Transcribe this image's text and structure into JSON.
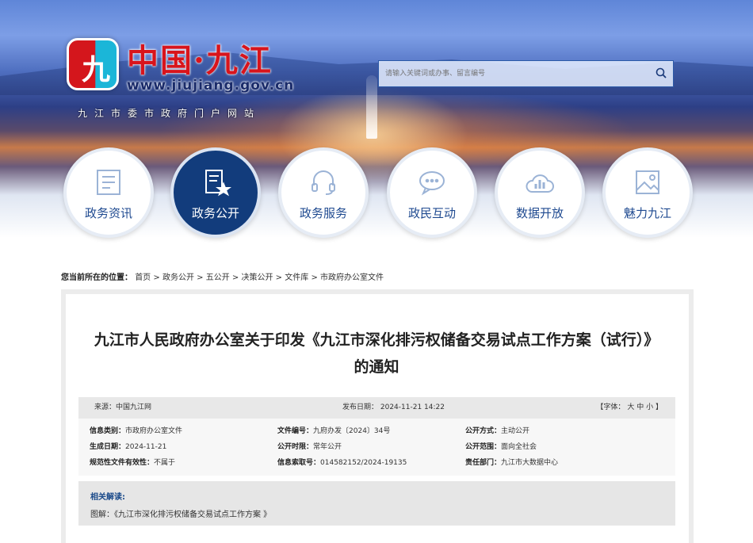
{
  "header": {
    "logo_text": "中国·九江",
    "logo_url": "www.jiujiang.gov.cn",
    "logo_sub": "九江市委市政府门户网站",
    "search_placeholder": "请输入关键词或办事、留言编号"
  },
  "nav": [
    {
      "label": "政务资讯",
      "icon": "newspaper-icon"
    },
    {
      "label": "政务公开",
      "icon": "document-star-icon",
      "active": true
    },
    {
      "label": "政务服务",
      "icon": "headset-icon"
    },
    {
      "label": "政民互动",
      "icon": "chat-icon"
    },
    {
      "label": "数据开放",
      "icon": "cloud-chart-icon"
    },
    {
      "label": "魅力九江",
      "icon": "image-icon"
    }
  ],
  "breadcrumb": {
    "label": "您当前所在的位置：",
    "items": [
      "首页",
      "政务公开",
      "五公开",
      "决策公开",
      "文件库",
      "市政府办公室文件"
    ],
    "sep": ">"
  },
  "article": {
    "title": "九江市人民政府办公室关于印发《九江市深化排污权储备交易试点工作方案（试行）》的通知",
    "source": "来源：中国九江网",
    "publish_date": "发布日期：  2024-11-21 14:22",
    "font_label": "【字体：",
    "font_large": "大",
    "font_medium": "中",
    "font_small": "小",
    "font_end": "】"
  },
  "info": [
    {
      "label": "信息类别：",
      "value": "市政府办公室文件"
    },
    {
      "label": "文件编号：",
      "value": "九府办发〔2024〕34号"
    },
    {
      "label": "公开方式：",
      "value": "主动公开"
    },
    {
      "label": "生成日期：",
      "value": "2024-11-21"
    },
    {
      "label": "公开时限：",
      "value": "常年公开"
    },
    {
      "label": "公开范围：",
      "value": "面向全社会"
    },
    {
      "label": "规范性文件有效性：",
      "value": "不属于"
    },
    {
      "label": "信息索取号：",
      "value": "014582152/2024-19135"
    },
    {
      "label": "责任部门：",
      "value": "九江市大数据中心"
    }
  ],
  "related": {
    "heading": "相关解读:",
    "prefix": "图解：",
    "link": "《九江市深化排污权储备交易试点工作方案 》"
  },
  "colors": {
    "nav_active": "#123c7c",
    "accent": "#1f4a90",
    "logo_red": "#d8141c"
  }
}
